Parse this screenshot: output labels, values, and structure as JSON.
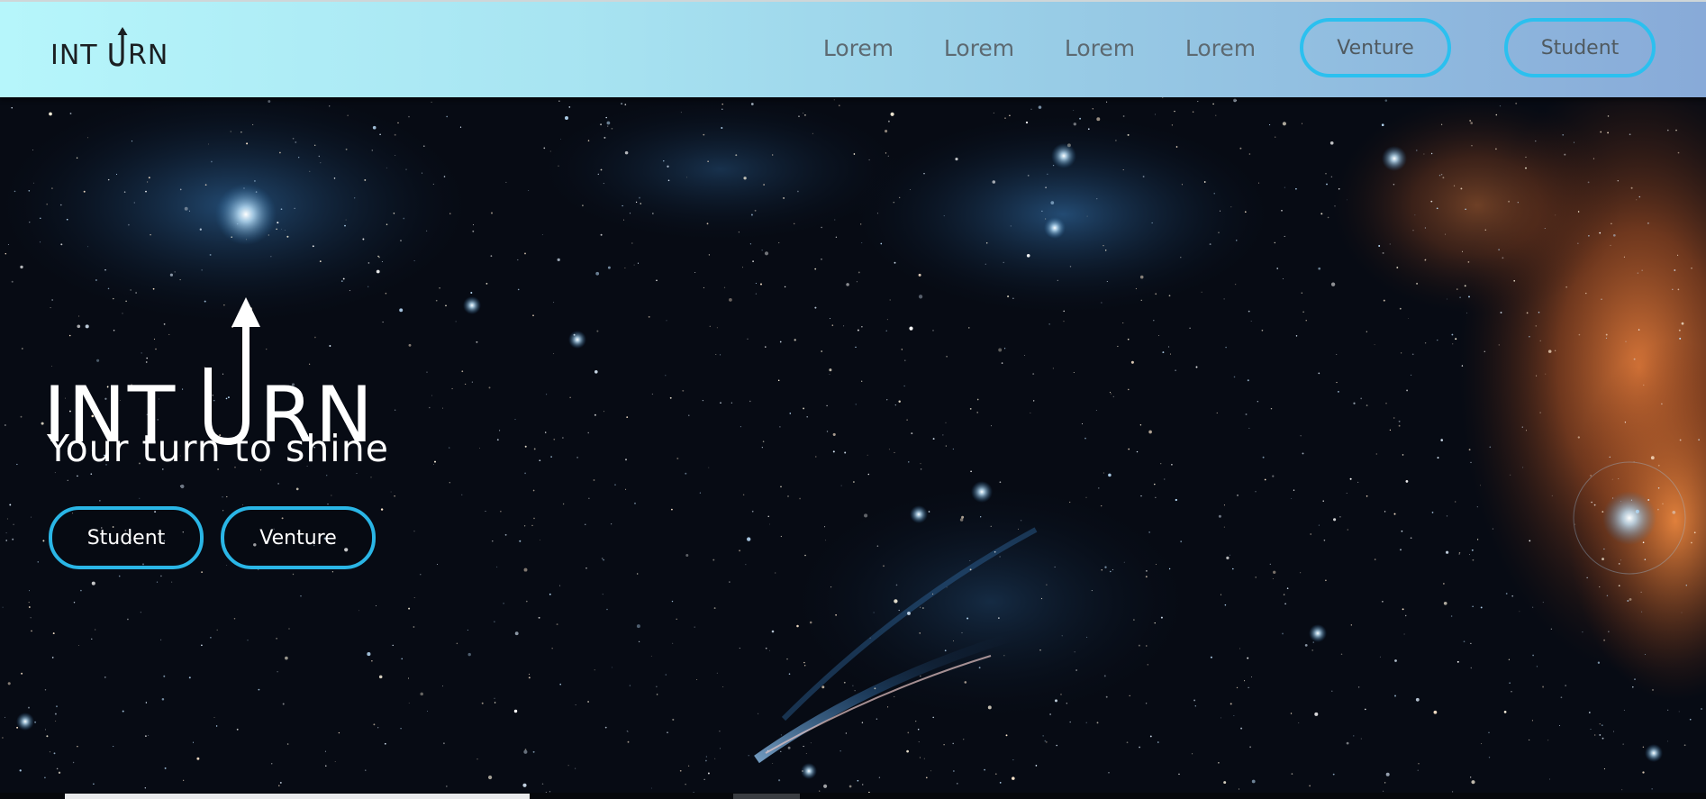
{
  "brand": {
    "logo_text": "INTURN"
  },
  "nav": {
    "links": [
      "Lorem",
      "Lorem",
      "Lorem",
      "Lorem"
    ],
    "venture_label": "Venture",
    "student_label": "Student"
  },
  "hero": {
    "logo_text": "INTURN",
    "tagline": "Your turn to shine",
    "student_label": "Student",
    "venture_label": "Venture"
  },
  "colors": {
    "accent": "#2bc0ef",
    "nav_gradient_start": "#b6f6fb",
    "nav_gradient_end": "#88aad8"
  }
}
